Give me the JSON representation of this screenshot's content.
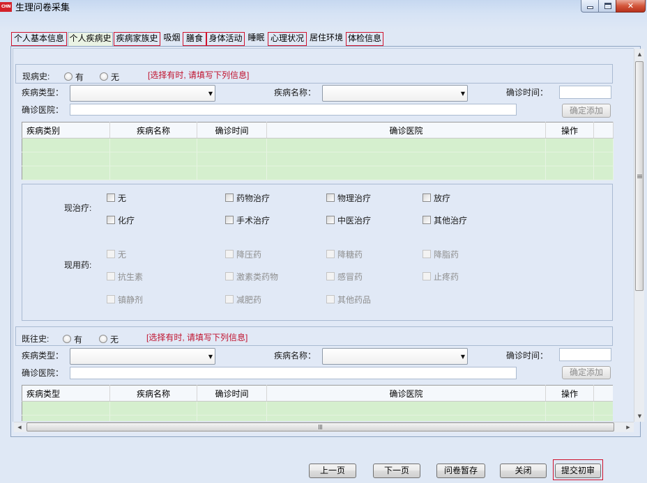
{
  "window": {
    "title": "生理问卷采集",
    "icon_label": "CHN"
  },
  "tabs": [
    "个人基本信息",
    "个人疾病史",
    "疾病家族史",
    "吸烟",
    "膳食",
    "身体活动",
    "睡眠",
    "心理状况",
    "居住环境",
    "体检信息"
  ],
  "current_history": {
    "label": "现病史:",
    "option_yes": "有",
    "option_no": "无",
    "hint": "[选择有时, 请填写下列信息]",
    "disease_type": {
      "label": "疾病类型：",
      "value": ""
    },
    "disease_name": {
      "label": "疾病名称：",
      "value": ""
    },
    "diagnosis_time": {
      "label": "确诊时间：",
      "value": ""
    },
    "hospital": {
      "label": "确诊医院：",
      "value": ""
    },
    "add_button": "确定添加",
    "table_headers": [
      "疾病类别",
      "疾病名称",
      "确诊时间",
      "确诊医院",
      "操作"
    ]
  },
  "treatment": {
    "label": "现治疗:",
    "options": [
      "无",
      "药物治疗",
      "物理治疗",
      "放疗",
      "化疗",
      "手术治疗",
      "中医治疗",
      "其他治疗"
    ]
  },
  "medication": {
    "label": "现用药:",
    "options": [
      "无",
      "降压药",
      "降糖药",
      "降脂药",
      "抗生素",
      "激素类药物",
      "感冒药",
      "止疼药",
      "镇静剂",
      "减肥药",
      "其他药品"
    ]
  },
  "past_history": {
    "label": "既往史:",
    "option_yes": "有",
    "option_no": "无",
    "hint": "[选择有时, 请填写下列信息]",
    "disease_type": {
      "label": "疾病类型：",
      "value": ""
    },
    "disease_name": {
      "label": "疾病名称：",
      "value": ""
    },
    "diagnosis_time": {
      "label": "确诊时间：",
      "value": ""
    },
    "hospital": {
      "label": "确诊医院：",
      "value": ""
    },
    "add_button": "确定添加",
    "table_headers": [
      "疾病类型",
      "疾病名称",
      "确诊时间",
      "确诊医院",
      "操作"
    ]
  },
  "footer": {
    "prev_button": "上一页",
    "next_button": "下一页",
    "save_draft_button": "问卷暂存",
    "close_button": "关闭",
    "submit_button": "提交初审"
  },
  "colors": {
    "highlight_red": "#d0112b",
    "hint_text": "#c0102c",
    "grid_row_green": "#d5efce",
    "window_bg": "#dfe8f5",
    "close_button_red": "#c8442b"
  },
  "icons": {
    "window_controls": [
      "minimize-icon",
      "maximize-icon",
      "close-icon"
    ],
    "dropdown": "chevron-down-icon",
    "scrollbar": [
      "scroll-up-icon",
      "scroll-down-icon",
      "scroll-left-icon",
      "scroll-right-icon",
      "grip-icon"
    ]
  }
}
